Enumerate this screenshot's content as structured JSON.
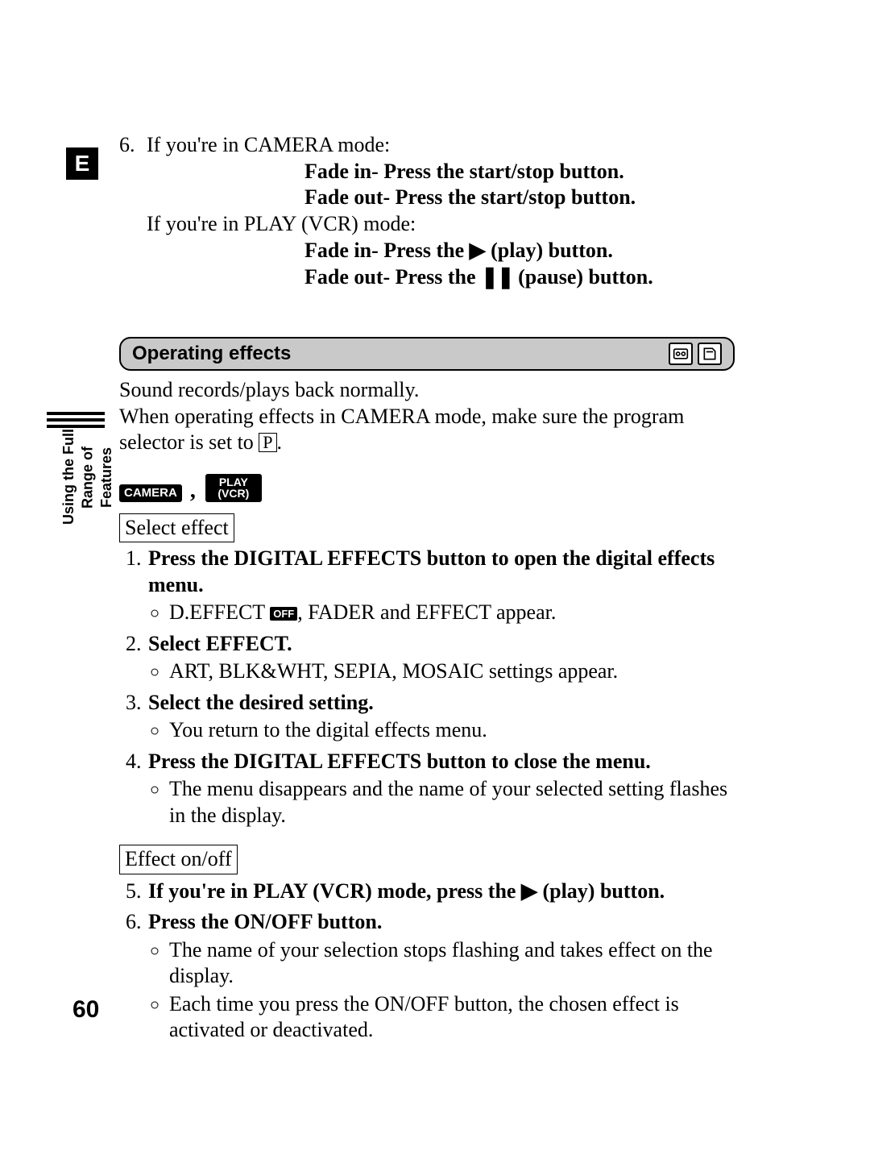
{
  "tab": "E",
  "side_text": "Using the Full\nRange of Features",
  "step6": {
    "num": "6.",
    "camera_intro": "If you're in CAMERA mode:",
    "camera_fade_in": "Fade in- Press the start/stop button.",
    "camera_fade_out": "Fade out- Press the start/stop button.",
    "vcr_intro": "If you're in PLAY (VCR) mode:",
    "vcr_fade_in_pre": "Fade in- Press the ",
    "vcr_fade_in_post": " (play) button.",
    "vcr_fade_out_pre": "Fade out- Press the ",
    "vcr_fade_out_post": " (pause) button."
  },
  "op_heading": "Operating effects",
  "op_p1": "Sound records/plays back normally.",
  "op_p2_pre": "When operating effects in CAMERA mode, make sure the program selector is set to ",
  "op_p2_p": "P",
  "op_p2_post": ".",
  "modes": {
    "camera": "CAMERA",
    "play1": "PLAY",
    "play2": "(VCR)"
  },
  "select_effect_box": "Select effect",
  "steps": {
    "s1": "Press the DIGITAL EFFECTS button to open the digital effects menu.",
    "s1_b1_pre": "D.EFFECT ",
    "s1_b1_off": "OFF",
    "s1_b1_post": ", FADER and EFFECT appear.",
    "s2": "Select EFFECT.",
    "s2_b1": "ART, BLK&WHT, SEPIA, MOSAIC settings appear.",
    "s3": "Select the desired setting.",
    "s3_b1": "You return to the digital effects menu.",
    "s4": "Press the DIGITAL EFFECTS button to close the menu.",
    "s4_b1": "The menu disappears and the name of your selected setting flashes in the display."
  },
  "effect_onoff_box": "Effect on/off",
  "steps2": {
    "s5_pre": "If you're in PLAY (VCR) mode, press the ",
    "s5_post": " (play) button.",
    "s6": "Press the ON/OFF button.",
    "s6_b1": "The name of your selection stops flashing and takes effect on the display.",
    "s6_b2": "Each time you press the ON/OFF button, the chosen effect is activated or deactivated."
  },
  "page_number": "60",
  "glyphs": {
    "play": "▶",
    "pause": "❚❚"
  }
}
